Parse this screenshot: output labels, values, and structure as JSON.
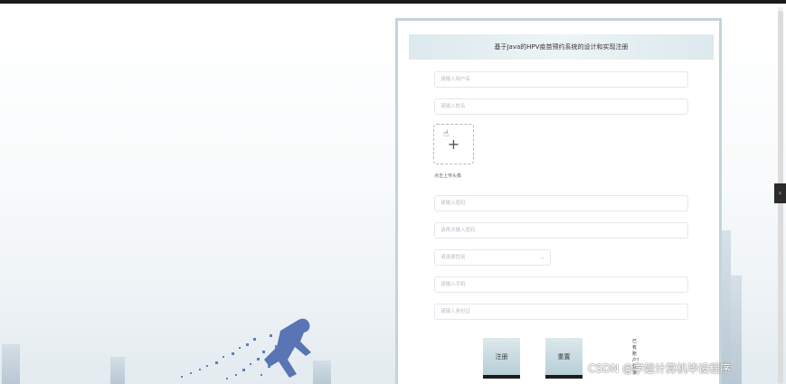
{
  "form": {
    "title": "基于Java的HPV疫苗预约系统的设计和实现注册",
    "username_placeholder": "请输入用户名",
    "name_placeholder": "请输入姓名",
    "avatar_label": "点击上传头像",
    "password_placeholder": "请输入密码",
    "confirm_password_placeholder": "请再次输入密码",
    "gender_placeholder": "请选择性别",
    "phone_placeholder": "请输入手机",
    "id_card_placeholder": "请输入身份证",
    "register_label": "注册",
    "reset_label": "重置",
    "login_link": "已有账户？登录"
  },
  "icons": {
    "upload": "plus-icon",
    "cursor": "hand-pointer-icon",
    "dropdown": "chevron-down-icon",
    "side_tab": "chevron-left-icon"
  },
  "watermark": "CSDN @学姐计算机毕设程序",
  "colors": {
    "panel_border": "#c4d4d9",
    "button_gradient_top": "#dce9ec",
    "button_gradient_bottom": "#b7cfd6"
  }
}
